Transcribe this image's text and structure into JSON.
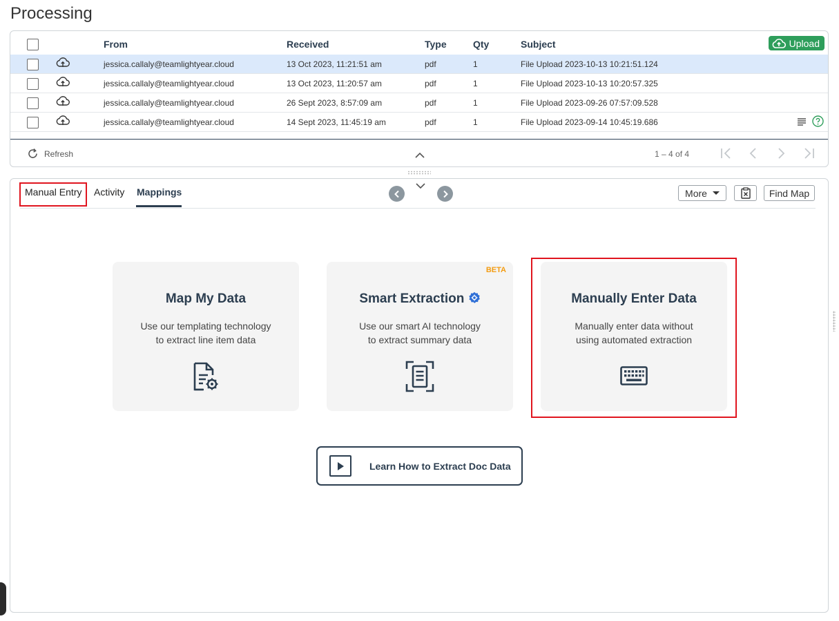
{
  "page": {
    "title": "Processing"
  },
  "grid": {
    "columns": {
      "from": "From",
      "received": "Received",
      "type": "Type",
      "qty": "Qty",
      "subject": "Subject"
    },
    "upload_label": "Upload",
    "rows": [
      {
        "from": "jessica.callaly@teamlightyear.cloud",
        "received": "13 Oct 2023, 11:21:51 am",
        "type": "pdf",
        "qty": "1",
        "subject": "File Upload 2023-10-13 10:21:51.124",
        "selected": true
      },
      {
        "from": "jessica.callaly@teamlightyear.cloud",
        "received": "13 Oct 2023, 11:20:57 am",
        "type": "pdf",
        "qty": "1",
        "subject": "File Upload 2023-10-13 10:20:57.325",
        "selected": false
      },
      {
        "from": "jessica.callaly@teamlightyear.cloud",
        "received": "26 Sept 2023, 8:57:09 am",
        "type": "pdf",
        "qty": "1",
        "subject": "File Upload 2023-09-26 07:57:09.528",
        "selected": false
      },
      {
        "from": "jessica.callaly@teamlightyear.cloud",
        "received": "14 Sept 2023, 11:45:19 am",
        "type": "pdf",
        "qty": "1",
        "subject": "File Upload 2023-09-14 10:45:19.686",
        "selected": false
      }
    ],
    "footer": {
      "refresh_label": "Refresh",
      "pager_text": "1 – 4 of 4"
    }
  },
  "tabs": {
    "manual_entry": "Manual Entry",
    "activity": "Activity",
    "mappings": "Mappings"
  },
  "toolbar": {
    "more_label": "More",
    "find_map_label": "Find Map"
  },
  "cards": {
    "map": {
      "title": "Map My Data",
      "desc_line1": "Use our templating technology",
      "desc_line2": "to extract line item data"
    },
    "smart": {
      "title": "Smart Extraction",
      "badge": "BETA",
      "desc_line1": "Use our smart AI technology",
      "desc_line2": "to extract summary data"
    },
    "manual": {
      "title": "Manually Enter Data",
      "desc_line1": "Manually enter data without",
      "desc_line2": "using automated extraction"
    }
  },
  "learn": {
    "label": "Learn How to Extract Doc Data"
  },
  "colors": {
    "accent": "#2c3e50",
    "upload": "#2e9e5b",
    "selected_row": "#dbe9fb",
    "highlight": "#e0141e",
    "beta": "#f39c12"
  }
}
